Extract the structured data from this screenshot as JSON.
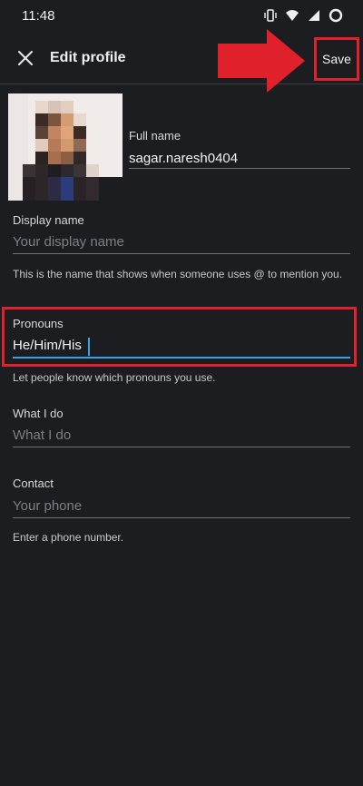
{
  "status_bar": {
    "time": "11:48"
  },
  "app_bar": {
    "title": "Edit profile",
    "save_label": "Save"
  },
  "fields": {
    "full_name": {
      "label": "Full name",
      "value": "sagar.naresh0404"
    },
    "display_name": {
      "label": "Display name",
      "placeholder": "Your display name",
      "helper": "This is the name that shows when someone uses @ to mention you."
    },
    "pronouns": {
      "label": "Pronouns",
      "value": "He/Him/His",
      "helper": "Let people know which pronouns you use."
    },
    "what_i_do": {
      "label": "What I do",
      "placeholder": "What I do"
    },
    "contact": {
      "label": "Contact",
      "placeholder": "Your phone",
      "helper": "Enter a phone number."
    }
  },
  "colors": {
    "background": "#1b1d21",
    "accent_cursor": "#3aa3e8",
    "annotation": "#e0202a"
  },
  "icons": [
    "vibrate-icon",
    "wifi-icon",
    "signal-icon",
    "battery-icon",
    "close-icon"
  ]
}
